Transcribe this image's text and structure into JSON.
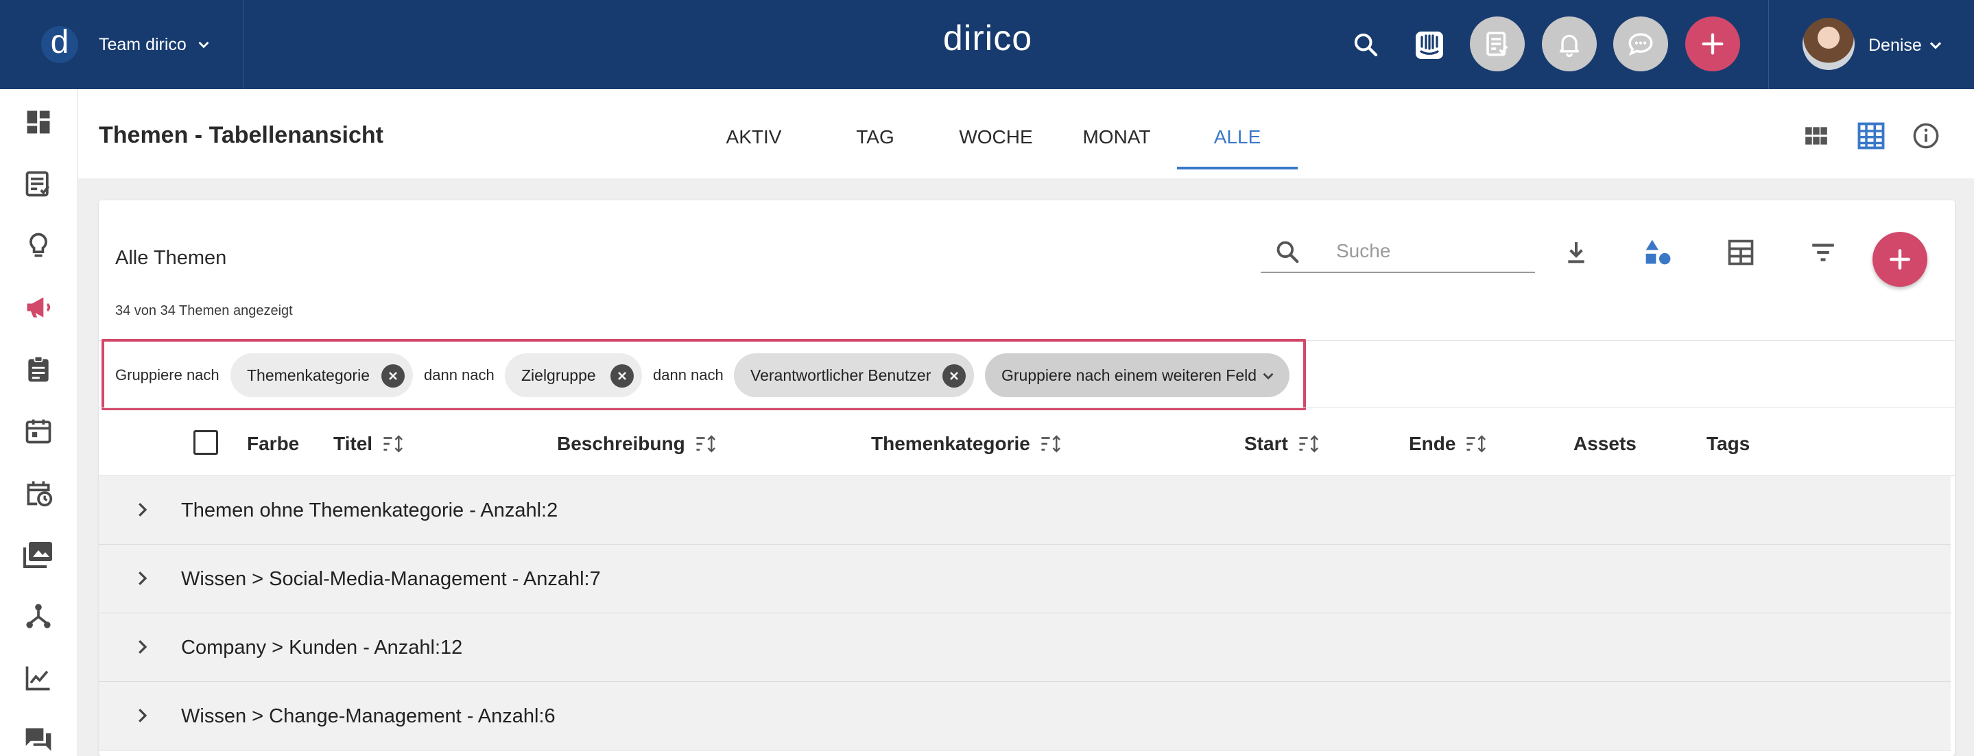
{
  "topbar": {
    "team_logo": "d",
    "team_name": "Team dirico",
    "brand": "dirico",
    "user_name": "Denise",
    "colors": {
      "bar": "#173b6f",
      "accent": "#d2486a"
    },
    "icons": [
      "search-icon",
      "intercom-icon",
      "tasks-icon",
      "bell-icon",
      "chat-icon",
      "plus-icon"
    ]
  },
  "sidebar": {
    "items": [
      "dashboard-icon",
      "checklist-icon",
      "lightbulb-icon",
      "megaphone-icon",
      "clipboard-icon",
      "calendar-icon",
      "calendar-clock-icon",
      "photos-icon",
      "network-icon",
      "chart-icon",
      "forum-icon"
    ],
    "active": "megaphone-icon"
  },
  "header": {
    "title": "Themen - Tabellenansicht",
    "tabs": [
      {
        "label": "AKTIV"
      },
      {
        "label": "TAG"
      },
      {
        "label": "WOCHE"
      },
      {
        "label": "MONAT"
      },
      {
        "label": "ALLE",
        "active": true
      }
    ]
  },
  "card": {
    "title": "Alle Themen",
    "subtitle": "34 von 34 Themen angezeigt",
    "search_placeholder": "Suche",
    "tools": [
      "download-icon",
      "shapes-icon",
      "table-columns-icon",
      "filter-icon",
      "add-icon"
    ]
  },
  "grouping": {
    "label_first": "Gruppiere nach",
    "then": "dann nach",
    "chips": [
      "Themenkategorie",
      "Zielgruppe",
      "Verantwortlicher Benutzer"
    ],
    "add_chip": "Gruppiere nach einem weiteren Feld"
  },
  "table": {
    "columns": [
      "Farbe",
      "Titel",
      "Beschreibung",
      "Themenkategorie",
      "Start",
      "Ende",
      "Assets",
      "Tags"
    ]
  },
  "groups": [
    {
      "label": "Themen ohne Themenkategorie  -  Anzahl:2"
    },
    {
      "label": "Wissen > Social-Media-Management  -  Anzahl:7"
    },
    {
      "label": "Company > Kunden  -  Anzahl:12"
    },
    {
      "label": "Wissen > Change-Management  -  Anzahl:6"
    }
  ]
}
